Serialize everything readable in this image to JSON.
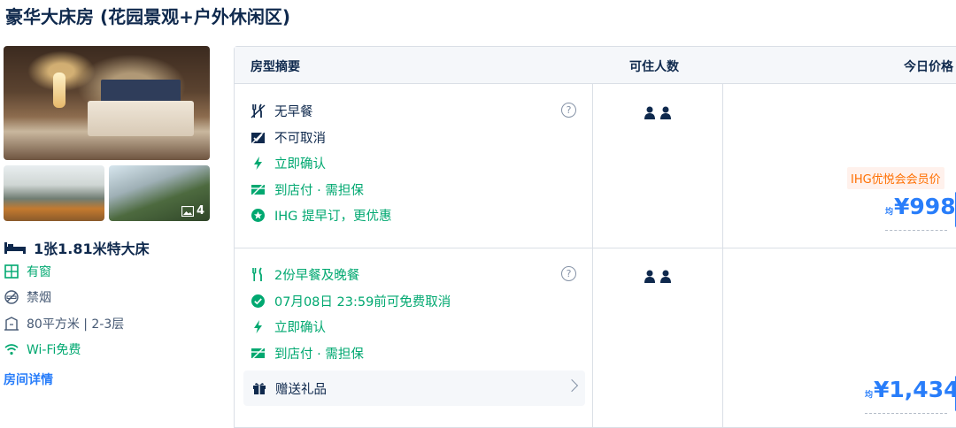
{
  "room": {
    "title": "豪华大床房 (花园景观+户外休闲区)",
    "photo_count": "4",
    "bed": "1张1.81米特大床",
    "features": [
      {
        "icon": "window-icon",
        "label": "有窗"
      },
      {
        "icon": "no-smoking-icon",
        "label": "禁烟"
      },
      {
        "icon": "area-icon",
        "label": "80平方米 | 2-3层"
      },
      {
        "icon": "wifi-icon",
        "label": "Wi-Fi免费"
      }
    ],
    "details_link": "房间详情"
  },
  "table": {
    "headers": {
      "summary": "房型摘要",
      "occupancy": "可住人数",
      "price": "今日价格"
    },
    "rows": [
      {
        "items": [
          {
            "icon": "no-breakfast-icon",
            "label": "无早餐",
            "style": "normal"
          },
          {
            "icon": "no-cancel-icon",
            "label": "不可取消",
            "style": "normal"
          },
          {
            "icon": "lightning-icon",
            "label": "立即确认",
            "style": "ok"
          },
          {
            "icon": "pay-at-hotel-icon",
            "label": "到店付 · 需担保",
            "style": "ok"
          },
          {
            "icon": "star-badge-icon",
            "label": "IHG 提早订，更优惠",
            "style": "ok"
          }
        ],
        "help": "?",
        "guests": 2,
        "member_badge": "IHG优悦会会员价",
        "price_prefix": "均",
        "price": "¥998"
      },
      {
        "items": [
          {
            "icon": "breakfast-icon",
            "label": "2份早餐及晚餐",
            "style": "ok"
          },
          {
            "icon": "check-circle-icon",
            "label": "07月08日 23:59前可免费取消",
            "style": "ok"
          },
          {
            "icon": "lightning-icon",
            "label": "立即确认",
            "style": "ok"
          },
          {
            "icon": "pay-at-hotel-icon",
            "label": "到店付 · 需担保",
            "style": "ok"
          }
        ],
        "help": "?",
        "gift": "赠送礼品",
        "guests": 2,
        "price_prefix": "均",
        "price": "¥1,434"
      }
    ]
  },
  "colors": {
    "accent": "#287dfa",
    "ok": "#00a870",
    "member": "#ff6f00",
    "text": "#0f294d"
  }
}
